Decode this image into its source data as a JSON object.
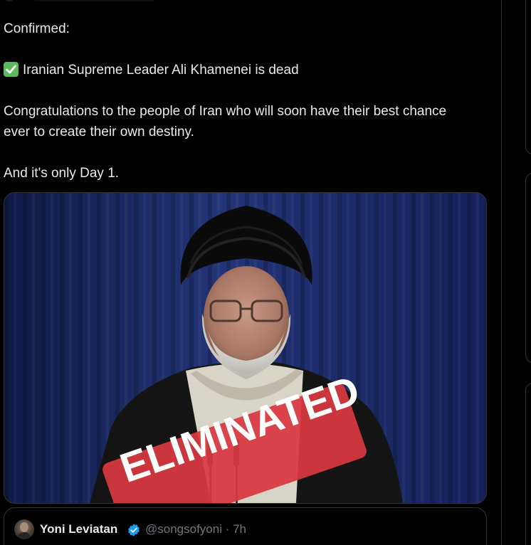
{
  "tweet": {
    "lines": [
      "Confirmed:",
      "Iranian Supreme Leader Ali Khamenei is dead",
      "Congratulations to the people of Iran who will soon have their best chance ever to create their own destiny.",
      "And it's only Day 1."
    ],
    "check_emoji": "check-mark-button-icon"
  },
  "media": {
    "overlay_stamp": "ELIMINATED",
    "stamp_color": "#d9383f",
    "backdrop_color": "#1e2d66"
  },
  "quote": {
    "name": "Yoni Leviatan",
    "handle_time": "@songsofyoni · 7h",
    "verified_color": "#1d9bf0"
  },
  "colors": {
    "background": "#000000",
    "text": "#e7e9ea",
    "muted": "#71767b",
    "border": "#2f3336"
  }
}
